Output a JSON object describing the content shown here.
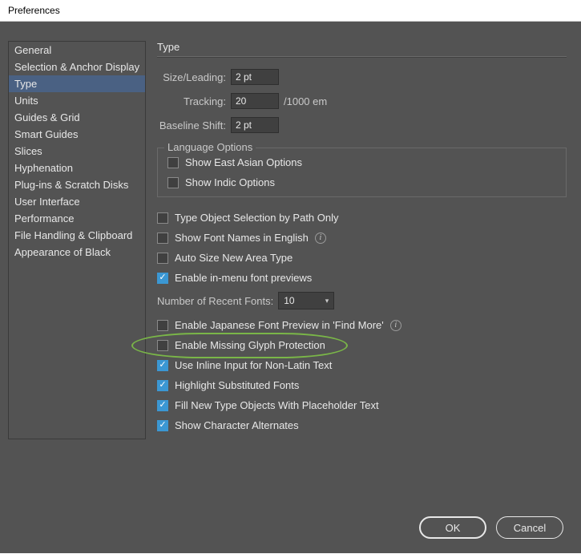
{
  "window": {
    "title": "Preferences"
  },
  "sidebar": {
    "items": [
      "General",
      "Selection & Anchor Display",
      "Type",
      "Units",
      "Guides & Grid",
      "Smart Guides",
      "Slices",
      "Hyphenation",
      "Plug-ins & Scratch Disks",
      "User Interface",
      "Performance",
      "File Handling & Clipboard",
      "Appearance of Black"
    ],
    "selected_index": 2
  },
  "panel": {
    "title": "Type",
    "fields": {
      "size_leading": {
        "label": "Size/Leading:",
        "value": "2 pt"
      },
      "tracking": {
        "label": "Tracking:",
        "value": "20",
        "unit": "/1000 em"
      },
      "baseline": {
        "label": "Baseline Shift:",
        "value": "2 pt"
      }
    },
    "language_group": {
      "legend": "Language Options",
      "east_asian": {
        "label": "Show East Asian Options",
        "checked": false
      },
      "indic": {
        "label": "Show Indic Options",
        "checked": false
      }
    },
    "checks": {
      "path_only": {
        "label": "Type Object Selection by Path Only",
        "checked": false
      },
      "english_names": {
        "label": "Show Font Names in English",
        "checked": false,
        "info": true
      },
      "auto_size": {
        "label": "Auto Size New Area Type",
        "checked": false
      },
      "in_menu_prev": {
        "label": "Enable in-menu font previews",
        "checked": true
      },
      "jp_preview": {
        "label": "Enable Japanese Font Preview in 'Find More'",
        "checked": false,
        "info": true
      },
      "glyph_protect": {
        "label": "Enable Missing Glyph Protection",
        "checked": false
      },
      "inline_input": {
        "label": "Use Inline Input for Non-Latin Text",
        "checked": true
      },
      "highlight_sub": {
        "label": "Highlight Substituted Fonts",
        "checked": true
      },
      "placeholder": {
        "label": "Fill New Type Objects With Placeholder Text",
        "checked": true
      },
      "char_alts": {
        "label": "Show Character Alternates",
        "checked": true
      }
    },
    "recent_fonts": {
      "label": "Number of Recent Fonts:",
      "value": "10"
    }
  },
  "buttons": {
    "ok": "OK",
    "cancel": "Cancel"
  }
}
